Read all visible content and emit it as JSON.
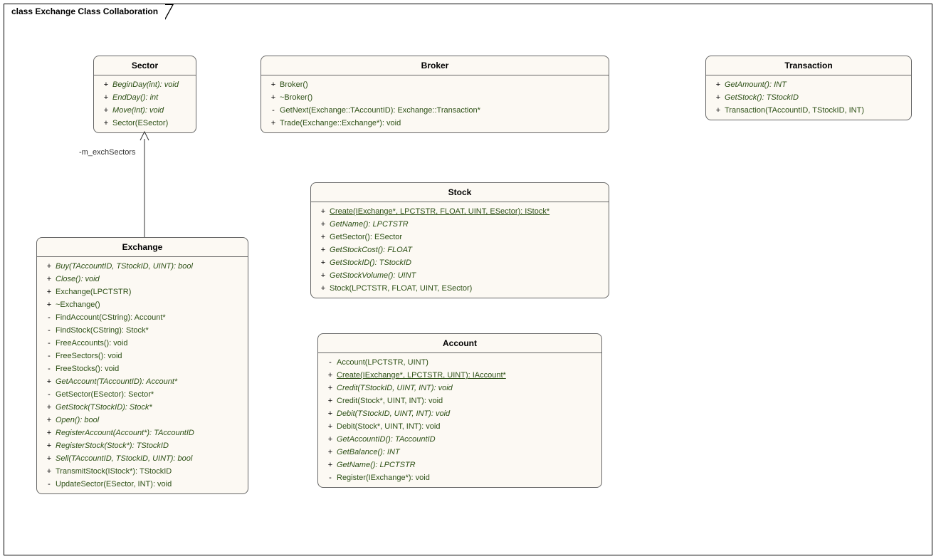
{
  "title": "class Exchange Class Collaboration",
  "assoc_label": "-m_exchSectors",
  "classes": {
    "sector": {
      "name": "Sector",
      "ops": [
        {
          "v": "+",
          "t": "BeginDay(int): void",
          "it": true
        },
        {
          "v": "+",
          "t": "EndDay(): int",
          "it": true
        },
        {
          "v": "+",
          "t": "Move(int): void",
          "it": true
        },
        {
          "v": "+",
          "t": "Sector(ESector)"
        }
      ]
    },
    "broker": {
      "name": "Broker",
      "ops": [
        {
          "v": "+",
          "t": "Broker()"
        },
        {
          "v": "+",
          "t": "~Broker()"
        },
        {
          "v": "-",
          "t": "GetNext(Exchange::TAccountID): Exchange::Transaction*"
        },
        {
          "v": "+",
          "t": "Trade(Exchange::Exchange*): void"
        }
      ]
    },
    "transaction": {
      "name": "Transaction",
      "ops": [
        {
          "v": "+",
          "t": "GetAmount(): INT",
          "it": true
        },
        {
          "v": "+",
          "t": "GetStock(): TStockID",
          "it": true
        },
        {
          "v": "+",
          "t": "Transaction(TAccountID, TStockID, INT)"
        }
      ]
    },
    "stock": {
      "name": "Stock",
      "ops": [
        {
          "v": "+",
          "t": "Create(IExchange*, LPCTSTR, FLOAT, UINT, ESector): IStock*",
          "ul": true
        },
        {
          "v": "+",
          "t": "GetName(): LPCTSTR",
          "it": true
        },
        {
          "v": "+",
          "t": "GetSector(): ESector"
        },
        {
          "v": "+",
          "t": "GetStockCost(): FLOAT",
          "it": true
        },
        {
          "v": "+",
          "t": "GetStockID(): TStockID",
          "it": true
        },
        {
          "v": "+",
          "t": "GetStockVolume(): UINT",
          "it": true
        },
        {
          "v": "+",
          "t": "Stock(LPCTSTR, FLOAT, UINT, ESector)"
        }
      ]
    },
    "account": {
      "name": "Account",
      "ops": [
        {
          "v": "-",
          "t": "Account(LPCTSTR, UINT)"
        },
        {
          "v": "+",
          "t": "Create(IExchange*, LPCTSTR, UINT): IAccount*",
          "ul": true
        },
        {
          "v": "+",
          "t": "Credit(TStockID, UINT, INT): void",
          "it": true
        },
        {
          "v": "+",
          "t": "Credit(Stock*, UINT, INT): void"
        },
        {
          "v": "+",
          "t": "Debit(TStockID, UINT, INT): void",
          "it": true
        },
        {
          "v": "+",
          "t": "Debit(Stock*, UINT, INT): void"
        },
        {
          "v": "+",
          "t": "GetAccountID(): TAccountID",
          "it": true
        },
        {
          "v": "+",
          "t": "GetBalance(): INT",
          "it": true
        },
        {
          "v": "+",
          "t": "GetName(): LPCTSTR",
          "it": true
        },
        {
          "v": "-",
          "t": "Register(IExchange*): void"
        }
      ]
    },
    "exchange": {
      "name": "Exchange",
      "ops": [
        {
          "v": "+",
          "t": "Buy(TAccountID, TStockID, UINT): bool",
          "it": true
        },
        {
          "v": "+",
          "t": "Close(): void",
          "it": true
        },
        {
          "v": "+",
          "t": "Exchange(LPCTSTR)"
        },
        {
          "v": "+",
          "t": "~Exchange()"
        },
        {
          "v": "-",
          "t": "FindAccount(CString): Account*"
        },
        {
          "v": "-",
          "t": "FindStock(CString): Stock*"
        },
        {
          "v": "-",
          "t": "FreeAccounts(): void"
        },
        {
          "v": "-",
          "t": "FreeSectors(): void"
        },
        {
          "v": "-",
          "t": "FreeStocks(): void"
        },
        {
          "v": "+",
          "t": "GetAccount(TAccountID): Account*",
          "it": true
        },
        {
          "v": "-",
          "t": "GetSector(ESector): Sector*"
        },
        {
          "v": "+",
          "t": "GetStock(TStockID): Stock*",
          "it": true
        },
        {
          "v": "+",
          "t": "Open(): bool",
          "it": true
        },
        {
          "v": "+",
          "t": "RegisterAccount(Account*): TAccountID",
          "it": true
        },
        {
          "v": "+",
          "t": "RegisterStock(Stock*): TStockID",
          "it": true
        },
        {
          "v": "+",
          "t": "Sell(TAccountID, TStockID, UINT): bool",
          "it": true
        },
        {
          "v": "+",
          "t": "TransmitStock(IStock*): TStockID"
        },
        {
          "v": "-",
          "t": "UpdateSector(ESector, INT): void"
        }
      ]
    }
  }
}
